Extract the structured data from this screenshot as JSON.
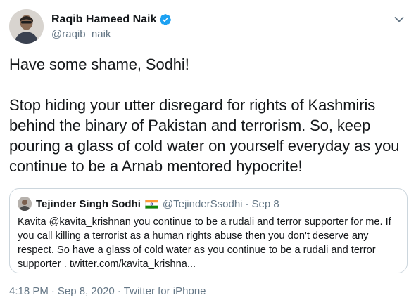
{
  "author": {
    "display_name": "Raqib Hameed Naik",
    "handle": "@raqib_naik",
    "verified": true
  },
  "tweet": {
    "lines": [
      "Have some shame, Sodhi!",
      "Stop hiding your utter disregard for rights of Kashmiris behind the binary of Pakistan and terrorism. So, keep pouring a glass of cold water on yourself everyday as you continue to be a Arnab mentored hypocrite!"
    ]
  },
  "quoted_tweet": {
    "display_name": "Tejinder Singh Sodhi",
    "flag_icon": "india-flag-icon",
    "handle": "@TejinderSsodhi",
    "separator": "·",
    "date": "Sep 8",
    "text": "Kavita @kavita_krishnan you continue to be a rudali and terror supporter for me. If you call killing a terrorist as a human rights abuse then you don't deserve any respect. So have a glass of cold water as you continue to be a rudali and terror supporter . twitter.com/kavita_krishna..."
  },
  "meta": {
    "time": "4:18 PM",
    "separator": "·",
    "date": "Sep 8, 2020",
    "source": "Twitter for iPhone"
  },
  "colors": {
    "text_primary": "#14171a",
    "text_secondary": "#657786",
    "verified_blue": "#1da1f2",
    "border": "#ccd6dd"
  }
}
